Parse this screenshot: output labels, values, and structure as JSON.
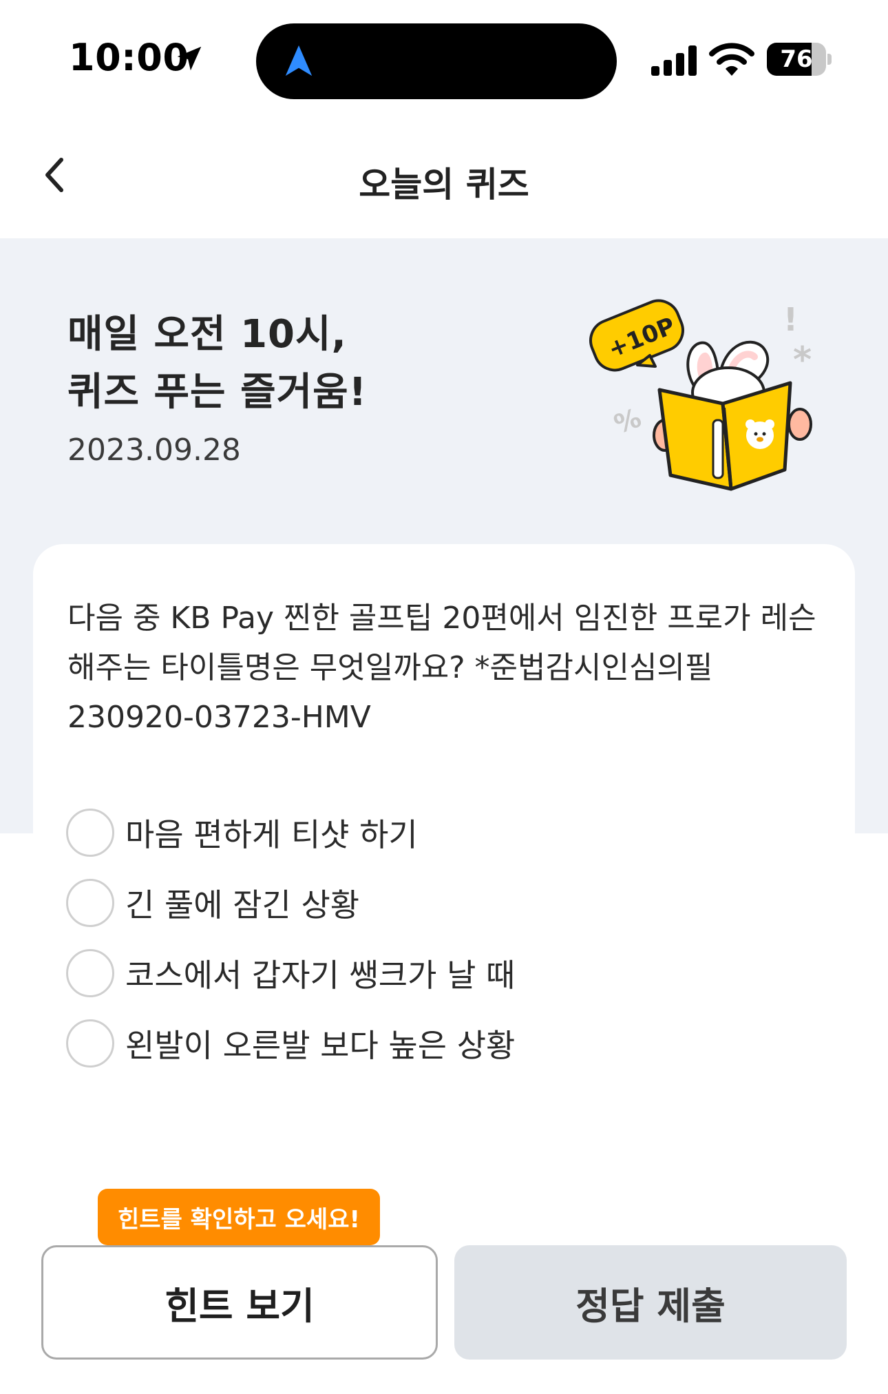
{
  "status_bar": {
    "time": "10:00",
    "battery_level": 76,
    "battery_text": "76",
    "icons": [
      "location-arrow-icon",
      "navigation-icon",
      "signal-bars-icon",
      "wifi-icon",
      "battery-icon"
    ]
  },
  "header": {
    "title": "오늘의 퀴즈",
    "back_icon": "chevron-left-icon"
  },
  "hero": {
    "title_line1": "매일 오전 10시,",
    "title_line2": "퀴즈 푸는 즐거움!",
    "date": "2023.09.28",
    "badge": "+10P"
  },
  "quiz": {
    "question_line1": "다음 중 KB Pay 찐한 골프팁 20편에서 임진한 프로가 레슨",
    "question_line2": "해주는 타이틀명은 무엇일까요? *준법감시인심의필",
    "question_line3": "230920-03723-HMV",
    "options": [
      {
        "label": "마음 편하게 티샷 하기"
      },
      {
        "label": "긴 풀에 잠긴 상황"
      },
      {
        "label": "코스에서 갑자기 쌩크가 날 때"
      },
      {
        "label": "왼발이 오른발 보다 높은 상황"
      }
    ]
  },
  "actions": {
    "hint_tooltip": "힌트를 확인하고 오세요!",
    "hint_button": "힌트 보기",
    "submit_button": "정답 제출"
  },
  "colors": {
    "accent_orange": "#ff8c00",
    "hero_background": "#eff2f7",
    "submit_button_bg": "#dfe3e8",
    "book_yellow": "#ffcc00"
  }
}
